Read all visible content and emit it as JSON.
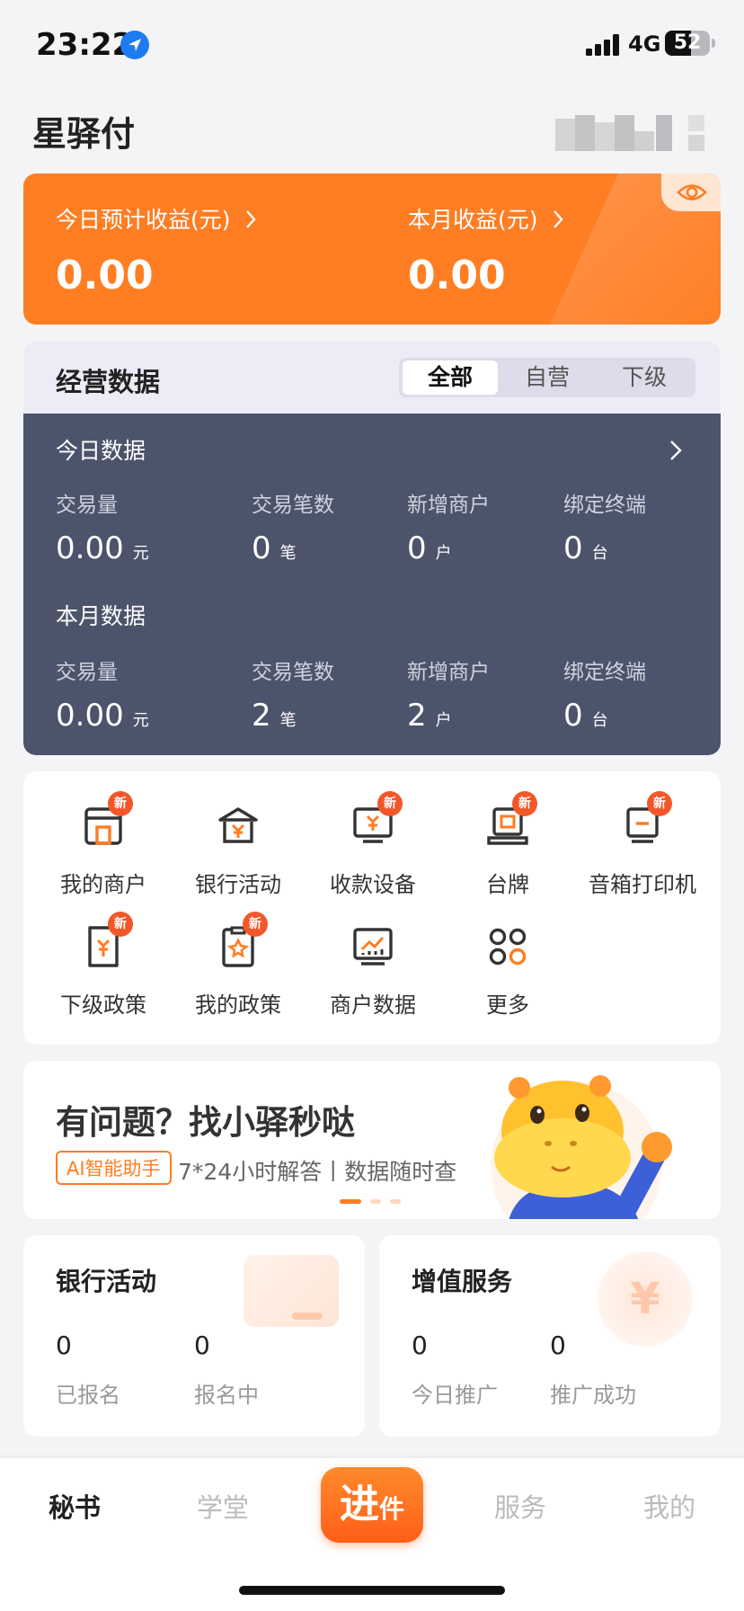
{
  "status_bar": {
    "time": "23:22",
    "network": "4G",
    "battery": "52"
  },
  "header": {
    "title": "星驿付"
  },
  "earnings": {
    "today_label": "今日预计收益(元)",
    "today_value": "0.00",
    "month_label": "本月收益(元)",
    "month_value": "0.00"
  },
  "business": {
    "title": "经营数据",
    "tabs": [
      "全部",
      "自营",
      "下级"
    ],
    "active_tab": "全部",
    "today": {
      "title": "今日数据",
      "stats": [
        {
          "label": "交易量",
          "value": "0.00",
          "unit": "元"
        },
        {
          "label": "交易笔数",
          "value": "0",
          "unit": "笔"
        },
        {
          "label": "新增商户",
          "value": "0",
          "unit": "户"
        },
        {
          "label": "绑定终端",
          "value": "0",
          "unit": "台"
        }
      ]
    },
    "month": {
      "title": "本月数据",
      "stats": [
        {
          "label": "交易量",
          "value": "0.00",
          "unit": "元"
        },
        {
          "label": "交易笔数",
          "value": "2",
          "unit": "笔"
        },
        {
          "label": "新增商户",
          "value": "2",
          "unit": "户"
        },
        {
          "label": "绑定终端",
          "value": "0",
          "unit": "台"
        }
      ]
    }
  },
  "menu": {
    "badge": "新",
    "items": [
      {
        "label": "我的商户",
        "icon": "store-icon",
        "new": true
      },
      {
        "label": "银行活动",
        "icon": "bank-icon",
        "new": false
      },
      {
        "label": "收款设备",
        "icon": "pos-device-icon",
        "new": true
      },
      {
        "label": "台牌",
        "icon": "table-sign-icon",
        "new": true
      },
      {
        "label": "音箱打印机",
        "icon": "speaker-printer-icon",
        "new": true
      },
      {
        "label": "下级政策",
        "icon": "sub-policy-icon",
        "new": true
      },
      {
        "label": "我的政策",
        "icon": "my-policy-icon",
        "new": true
      },
      {
        "label": "商户数据",
        "icon": "merchant-data-icon",
        "new": false
      },
      {
        "label": "更多",
        "icon": "more-icon",
        "new": false
      }
    ]
  },
  "banner": {
    "title": "有问题？找小驿秒哒",
    "tag": "AI智能助手",
    "subtitle": "7*24小时解答丨数据随时查",
    "active_slide": 1,
    "slide_count": 3
  },
  "bank_card": {
    "title": "银行活动",
    "stats": [
      {
        "value": "0",
        "label": "已报名"
      },
      {
        "value": "0",
        "label": "报名中"
      }
    ]
  },
  "vas_card": {
    "title": "增值服务",
    "deco_symbol": "¥",
    "stats": [
      {
        "value": "0",
        "label": "今日推广"
      },
      {
        "value": "0",
        "label": "推广成功"
      }
    ]
  },
  "tabbar": {
    "items": [
      "秘书",
      "学堂",
      "服务",
      "我的"
    ],
    "center_big": "进",
    "center_small": "件",
    "active": "秘书"
  },
  "colors": {
    "accent": "#ff7d23",
    "dark_panel": "#4c546c",
    "badge": "#f2572a"
  }
}
